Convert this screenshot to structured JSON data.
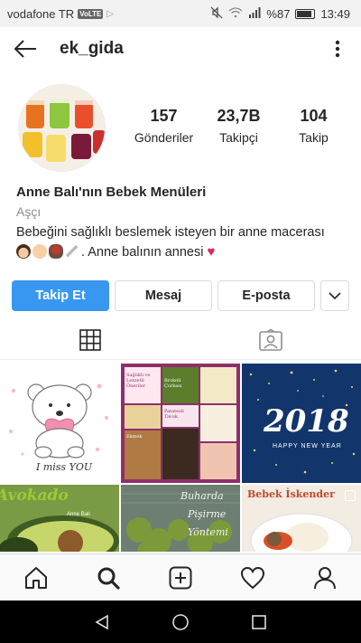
{
  "status_bar": {
    "carrier": "vodafone TR",
    "volte": "VoLTE",
    "battery": "%87",
    "time": "13:49",
    "battery_level": 0.87
  },
  "header": {
    "username": "ek_gida"
  },
  "stats": [
    {
      "value": "157",
      "label": "Gönderiler"
    },
    {
      "value": "23,7B",
      "label": "Takipçi"
    },
    {
      "value": "104",
      "label": "Takip"
    }
  ],
  "bio": {
    "name": "Anne Balı'nın Bebek Menüleri",
    "category": "Aşçı",
    "line1": "Bebeğini sağlıklı beslemek isteyen bir anne macerası",
    "line2": ". Anne balının annesi"
  },
  "actions": {
    "follow": "Takip Et",
    "message": "Mesaj",
    "email": "E-posta"
  },
  "posts": {
    "p1_caption": "I miss YOU",
    "p2_t1": "Sağlıklı ve Lezzetli Öneriler",
    "p2_t2": "Brokoli Çorbası",
    "p2_t3": "Patatesli Tavuk",
    "p2_t4": "Ekmek",
    "p3_year": "2018",
    "p3_sub": "HAPPY NEW YEAR",
    "p4_caption": "Avokado",
    "p4_sub": "Anne Balı",
    "p5_l1": "Buharda",
    "p5_l2": "Pişirme",
    "p5_l3": "Yöntemi",
    "p6_caption": "Bebek İskender"
  },
  "colors": {
    "accent": "#3897f0",
    "text": "#262626",
    "muted": "#8e8e8e",
    "border": "#dbdbdb"
  }
}
